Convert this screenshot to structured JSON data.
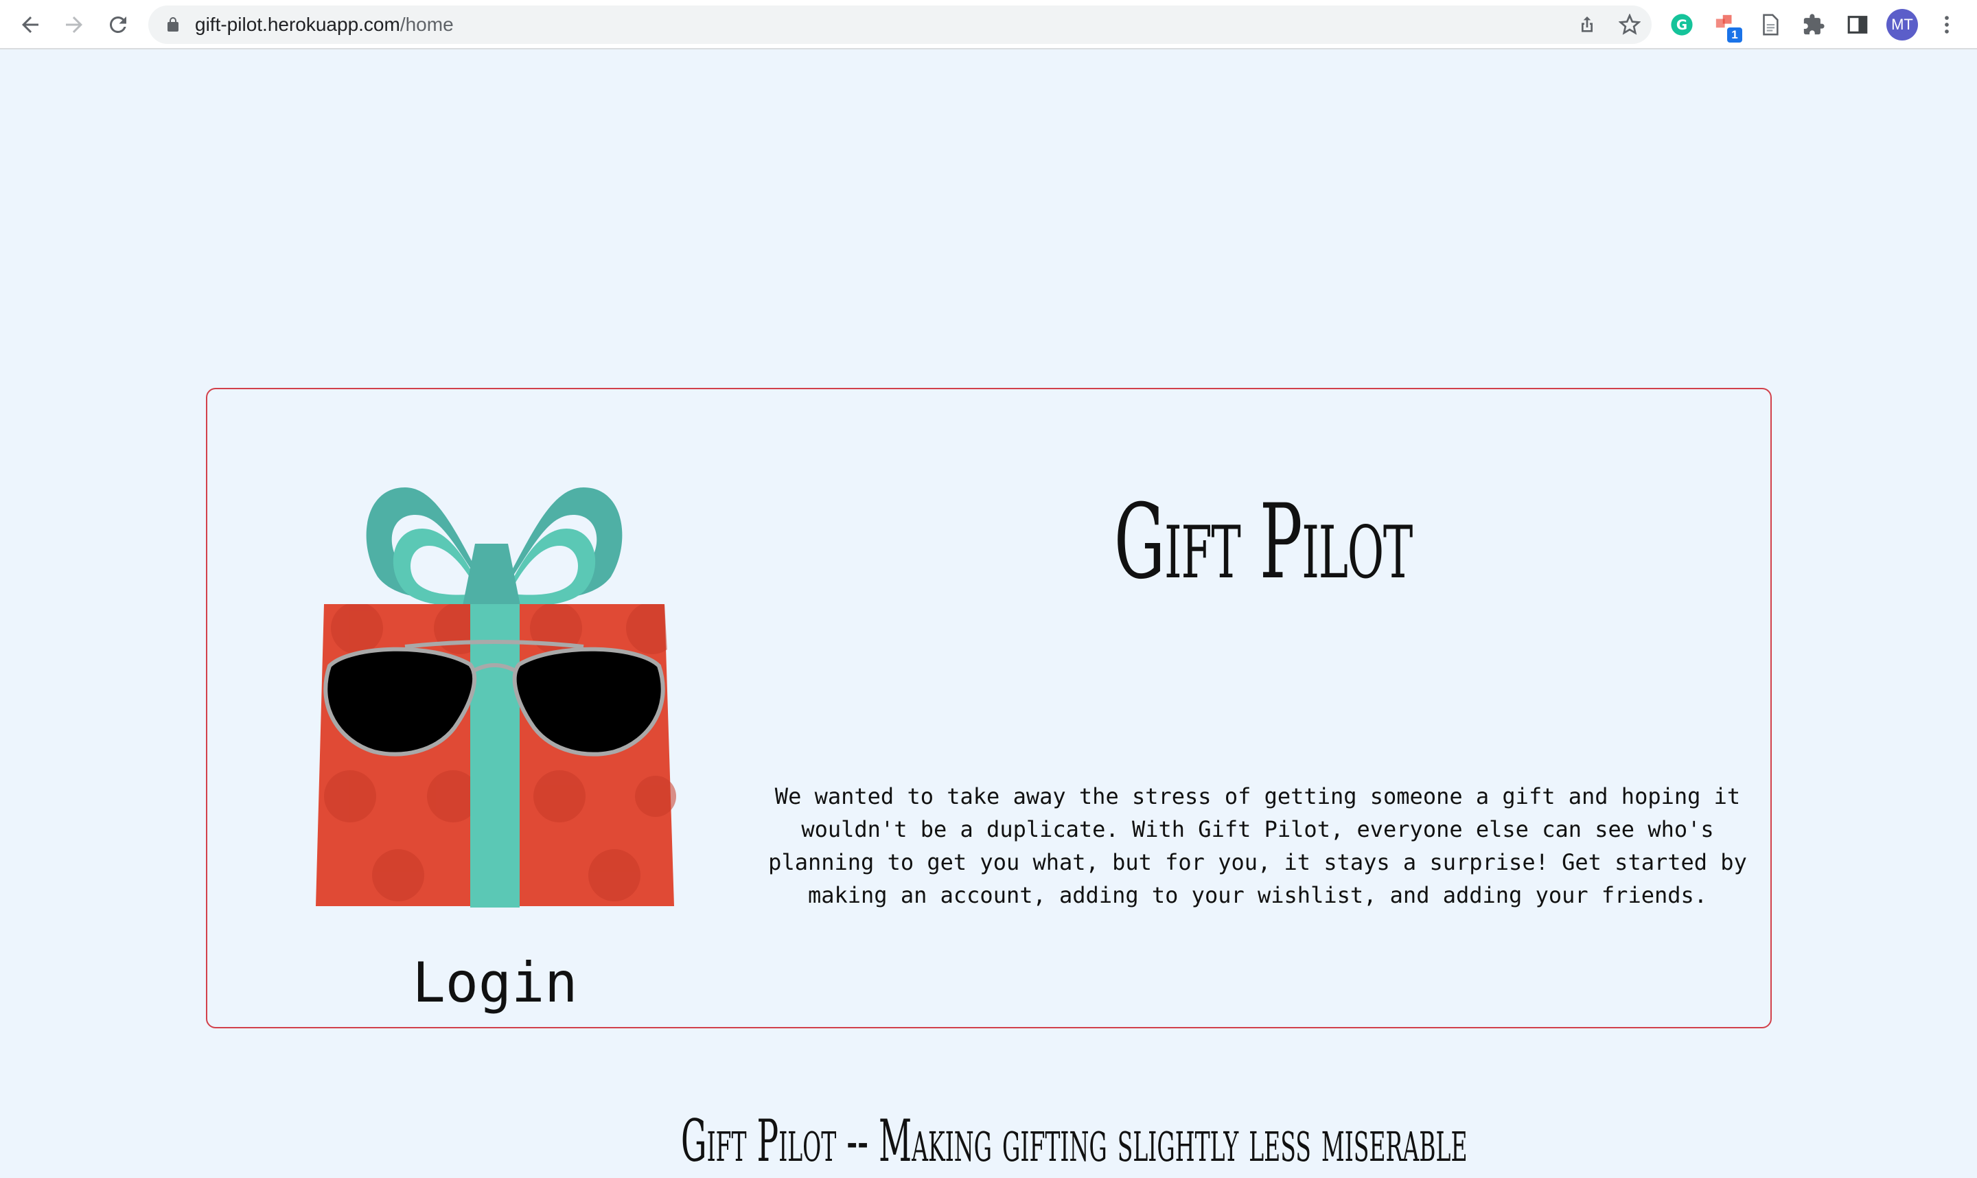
{
  "browser": {
    "url_host": "gift-pilot.herokuapp.com",
    "url_path": "/home",
    "extension_badge": "1",
    "profile_initials": "MT",
    "icons": {
      "back": "arrow-left-icon",
      "forward": "arrow-right-icon",
      "reload": "reload-icon",
      "lock": "lock-icon",
      "share": "share-icon",
      "bookmark": "star-icon",
      "grammarly": "grammarly-icon",
      "extension": "extension-icon",
      "document": "document-icon",
      "extensions_menu": "puzzle-icon",
      "side_panel": "side-panel-icon",
      "menu": "kebab-menu-icon"
    }
  },
  "hero": {
    "title": "Gift Pilot",
    "description": "We wanted to take away the stress of getting someone a gift and hoping it wouldn't be a duplicate. With Gift Pilot, everyone else can see who's planning to get you what, but for you, it stays a surprise! Get started by making an account, adding to your wishlist, and adding your friends.",
    "login_label": "Login",
    "image": "gift-with-sunglasses-illustration"
  },
  "footer": {
    "tagline": "Gift Pilot -- Making gifting slightly less miserable"
  },
  "colors": {
    "page_background": "#edf5fd",
    "card_border": "#d2404a",
    "gift_box": "#e04a35",
    "ribbon": "#5bc8b5",
    "ribbon_dark": "#4fb0a5",
    "sunglasses": "#000000",
    "frame": "#a9a9a9"
  }
}
